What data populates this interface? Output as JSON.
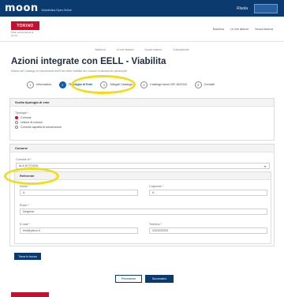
{
  "topbar": {
    "logo": "moon",
    "logo_sub": "Modulistica Open Online",
    "user": "Risola",
    "colors": {
      "bg": "#0b3a6e"
    }
  },
  "header": {
    "brand_name": "TORINO",
    "brand_sub": "Città metropolitana di Torino",
    "nav": [
      "Bacheca",
      "Le mie istanze",
      "Nuova istanza"
    ]
  },
  "breadcrumb": [
    "Bacheca",
    "Le mie istanze",
    "Nuova istanza",
    "Compilazione"
  ],
  "page": {
    "title": "Azioni integrate con EELL - Viabilita",
    "subtitle": "Misura del Catalogo di investimenti dell'Ente della Viabilità dei Comuni di attuazione partecipati"
  },
  "stepper": [
    {
      "num": "1",
      "label": "Informativa",
      "active": false
    },
    {
      "num": "2",
      "label": "Tipologia di Ente",
      "active": true
    },
    {
      "num": "3",
      "label": "Allegati Catalogo",
      "active": false
    },
    {
      "num": "4",
      "label": "Catalogo lavori DR 16/2018",
      "active": false
    },
    {
      "num": "5",
      "label": "Contatti",
      "active": false
    }
  ],
  "panel_ente": {
    "title": "Scelta tipologia di ente",
    "field_label": "Tipologia *",
    "options": [
      "Comune",
      "Unione di comuni",
      "Comune capofila di convenzione"
    ],
    "selected_index": 0
  },
  "panel_comune": {
    "title": "Comune",
    "field_label": "Comune di *",
    "value": "ALA DI STURA",
    "sub_title": "Referente",
    "fields": {
      "nome_label": "Nome *",
      "nome_value": "A",
      "cognome_label": "Cognome *",
      "cognome_value": "A",
      "ruolo_label": "Ruolo *",
      "ruolo_value": "Dirigente",
      "email_label": "E-mail *",
      "email_value": "test@yahoo.it",
      "telefono_label": "Telefono *",
      "telefono_value": "3333333333"
    }
  },
  "buttons": {
    "back_to_list": "Torna in bozza",
    "prev": "Precedente",
    "next": "Successivo"
  }
}
